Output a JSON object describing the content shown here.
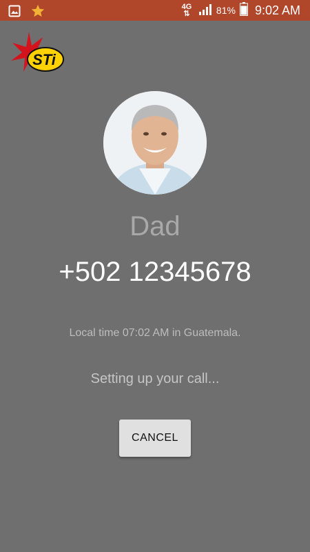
{
  "status_bar": {
    "icons_left": [
      "image-icon",
      "star-icon"
    ],
    "network_label": "4G",
    "battery_percent": "81%",
    "time": "9:02 AM",
    "color": "#b0462a"
  },
  "brand": {
    "logo_text": "STi"
  },
  "contact": {
    "name": "Dad",
    "number": "+502 12345678"
  },
  "call": {
    "local_time": "Local time 07:02 AM in Guatemala.",
    "status": "Setting up your call...",
    "cancel_label": "CANCEL"
  }
}
